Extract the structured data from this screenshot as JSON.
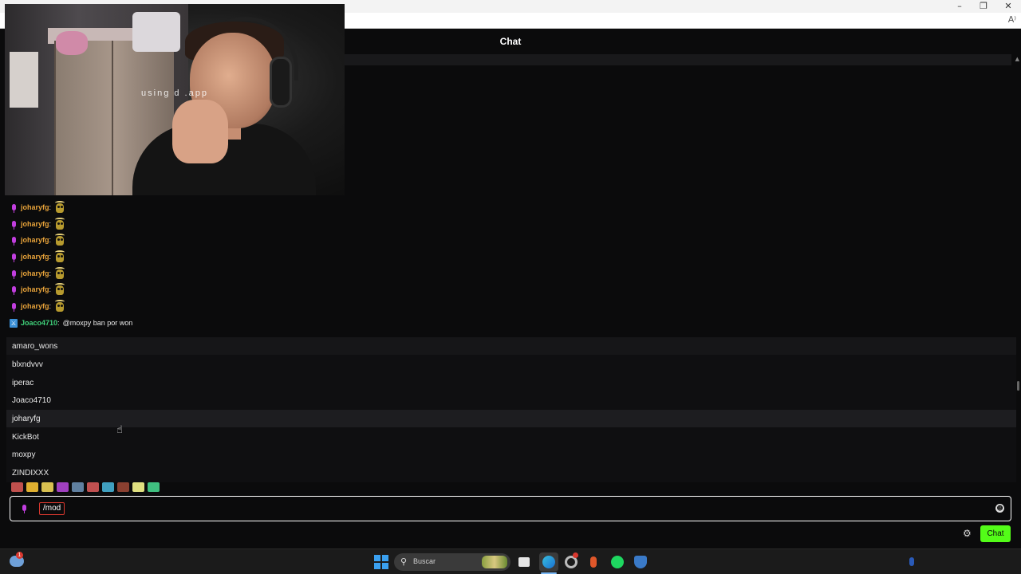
{
  "header": {
    "title": "Chat"
  },
  "webcam": {
    "watermark": "using d       .app"
  },
  "messages": [
    {
      "user": "joharyfg",
      "text": "",
      "badge": "mic-icon",
      "emote": "cat-emote"
    },
    {
      "user": "joharyfg",
      "text": "",
      "badge": "mic-icon",
      "emote": "cat-emote"
    },
    {
      "user": "joharyfg",
      "text": "",
      "badge": "mic-icon",
      "emote": "cat-emote"
    },
    {
      "user": "joharyfg",
      "text": "",
      "badge": "mic-icon",
      "emote": "cat-emote"
    },
    {
      "user": "joharyfg",
      "text": "",
      "badge": "mic-icon",
      "emote": "cat-emote"
    },
    {
      "user": "joharyfg",
      "text": "",
      "badge": "mic-icon",
      "emote": "cat-emote"
    },
    {
      "user": "joharyfg",
      "text": "",
      "badge": "mic-icon",
      "emote": "cat-emote"
    },
    {
      "user": "Joaco4710",
      "text": "@moxpy ban por won",
      "badge": "moderator-icon",
      "emote": ""
    }
  ],
  "message_separator": ":",
  "user_suggestions": [
    "amaro_wons",
    "blxndvvv",
    "iperac",
    "Joaco4710",
    "joharyfg",
    "KickBot",
    "moxpy",
    "ZINDIXXX"
  ],
  "emote_bar": [
    "#c0504d",
    "#e0b030",
    "#d8c050",
    "#a040c0",
    "#6080a0",
    "#c05050",
    "#40a0c0",
    "#8a4030",
    "#e0e080",
    "#40c080"
  ],
  "input": {
    "command": "/mod"
  },
  "actions": {
    "send_label": "Chat",
    "settings_icon": "gear-icon",
    "emoji_icon": "emoji-icon"
  },
  "taskbar": {
    "search_placeholder": "Buscar",
    "weather_badge": "1"
  },
  "colors": {
    "accent": "#53fc18",
    "username": "#e8a33a",
    "moderator": "#3fd17a",
    "mic_badge": "#c23ee0"
  }
}
